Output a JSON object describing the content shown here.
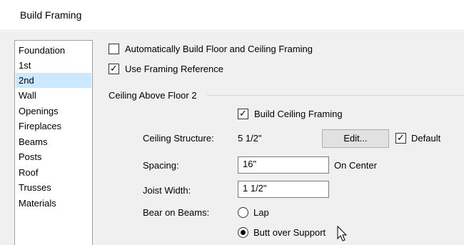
{
  "window": {
    "title": "Build Framing"
  },
  "sidebar": {
    "items": [
      {
        "label": "Foundation",
        "selected": false
      },
      {
        "label": "1st",
        "selected": false
      },
      {
        "label": "2nd",
        "selected": true
      },
      {
        "label": "Wall",
        "selected": false
      },
      {
        "label": "Openings",
        "selected": false
      },
      {
        "label": "Fireplaces",
        "selected": false
      },
      {
        "label": "Beams",
        "selected": false
      },
      {
        "label": "Posts",
        "selected": false
      },
      {
        "label": "Roof",
        "selected": false
      },
      {
        "label": "Trusses",
        "selected": false
      },
      {
        "label": "Materials",
        "selected": false
      }
    ]
  },
  "options": {
    "auto_build": {
      "label": "Automatically Build Floor and Ceiling Framing",
      "checked": false
    },
    "use_reference": {
      "label": "Use Framing Reference",
      "checked": true
    }
  },
  "ceiling_group": {
    "title": "Ceiling Above Floor 2",
    "build_ceiling": {
      "label": "Build Ceiling Framing",
      "checked": true
    },
    "structure": {
      "label": "Ceiling Structure:",
      "value": "5 1/2\"",
      "edit_label": "Edit...",
      "default_label": "Default",
      "default_checked": true
    },
    "spacing": {
      "label": "Spacing:",
      "value": "16\"",
      "unit": "On Center"
    },
    "joist_width": {
      "label": "Joist Width:",
      "value": "1 1/2\""
    },
    "bear_on_beams": {
      "label": "Bear on Beams:",
      "options": [
        {
          "label": "Lap",
          "selected": false
        },
        {
          "label": "Butt over Support",
          "selected": true
        }
      ]
    }
  },
  "check_glyph": "✓"
}
